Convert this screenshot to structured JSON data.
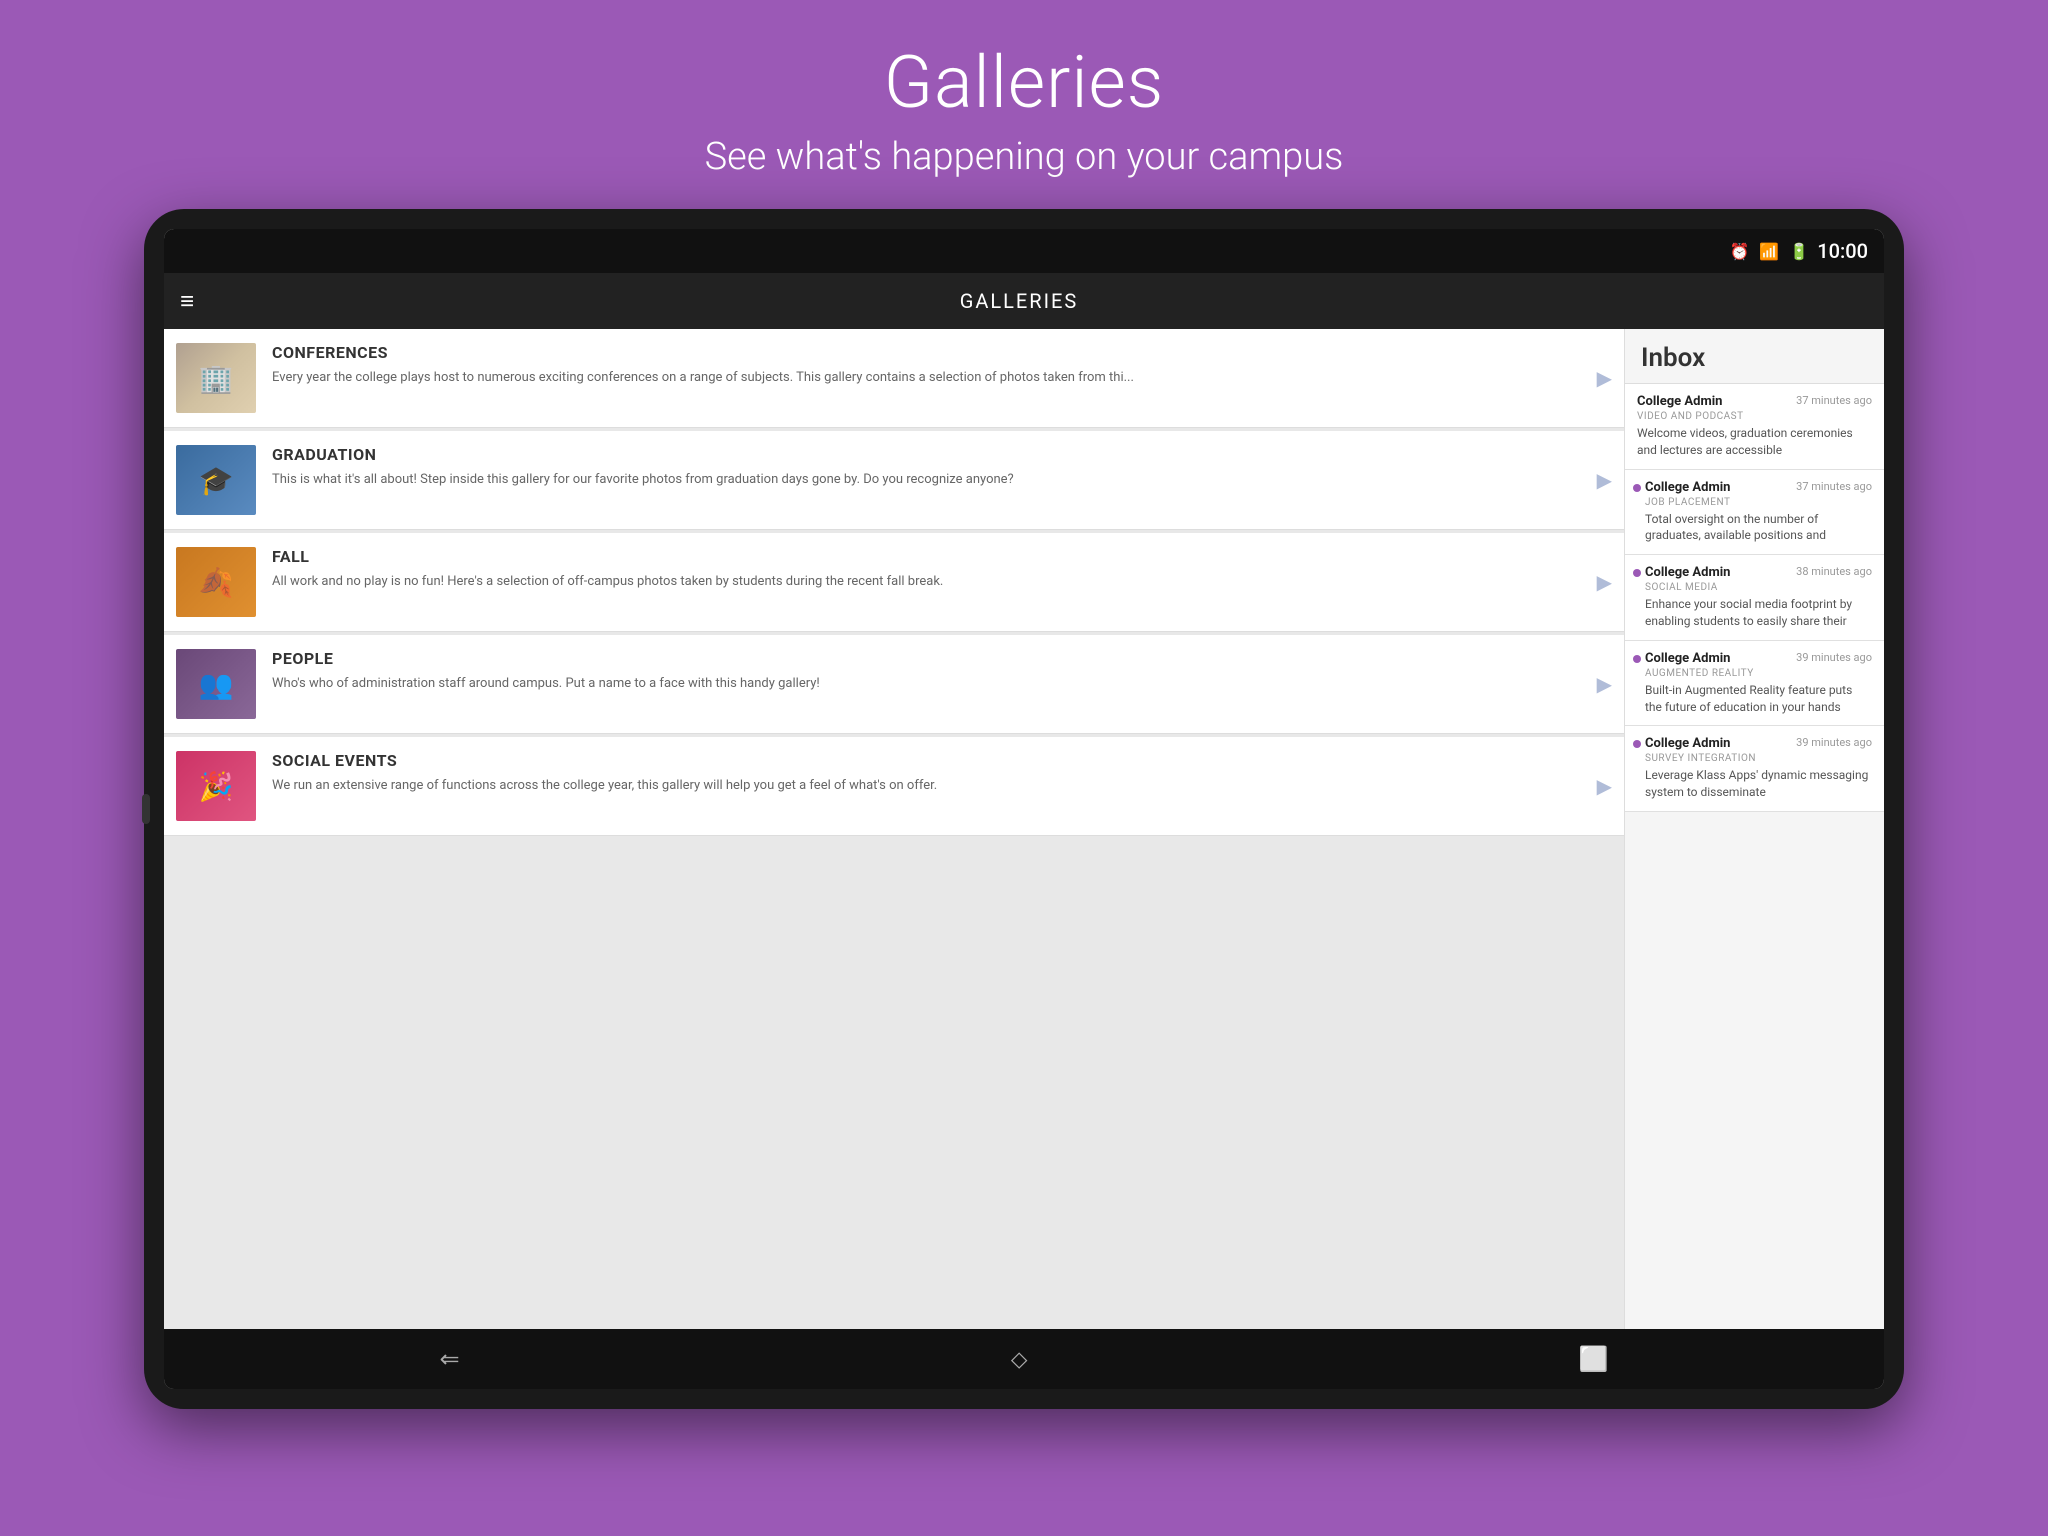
{
  "page": {
    "title": "Galleries",
    "subtitle": "See what's happening on your campus",
    "background_color": "#9b59b6"
  },
  "status_bar": {
    "time": "10:00",
    "icons": [
      "⏰",
      "📶",
      "🔋"
    ]
  },
  "app_bar": {
    "title": "GALLERIES",
    "menu_icon": "≡"
  },
  "gallery_items": [
    {
      "id": "conferences",
      "name": "CONFERENCES",
      "description": "Every year the college plays host to numerous exciting conferences on a range of subjects.  This gallery contains a selection of photos taken from thi...",
      "thumb_class": "thumb-conferences"
    },
    {
      "id": "graduation",
      "name": "GRADUATION",
      "description": "This is what it's all about!  Step inside this gallery for our favorite photos from graduation days gone by.  Do you recognize anyone?",
      "thumb_class": "thumb-graduation"
    },
    {
      "id": "fall",
      "name": "FALL",
      "description": "All work and no play is no fun!  Here's a selection of off-campus photos taken by students during the recent fall break.",
      "thumb_class": "thumb-fall"
    },
    {
      "id": "people",
      "name": "PEOPLE",
      "description": "Who's who of administration staff around campus.  Put a name to a face with this handy gallery!",
      "thumb_class": "thumb-people"
    },
    {
      "id": "social-events",
      "name": "SOCIAL EVENTS",
      "description": "We run an extensive range of functions across the college year, this gallery will help you get a feel of what's on offer.",
      "thumb_class": "thumb-social-events"
    }
  ],
  "inbox": {
    "title": "Inbox",
    "messages": [
      {
        "sender": "College Admin",
        "time": "37 minutes ago",
        "category": "VIDEO AND PODCAST",
        "preview": "Welcome videos, graduation ceremonies and lectures are accessible",
        "has_dot": false
      },
      {
        "sender": "College Admin",
        "time": "37 minutes ago",
        "category": "JOB PLACEMENT",
        "preview": "Total oversight on the number of graduates, available positions and",
        "has_dot": true
      },
      {
        "sender": "College Admin",
        "time": "38 minutes ago",
        "category": "SOCIAL MEDIA",
        "preview": "Enhance your social media footprint by enabling students to easily share their",
        "has_dot": true
      },
      {
        "sender": "College Admin",
        "time": "39 minutes ago",
        "category": "AUGMENTED REALITY",
        "preview": "Built-in Augmented Reality feature puts the future of education in your hands",
        "has_dot": true
      },
      {
        "sender": "College Admin",
        "time": "39 minutes ago",
        "category": "SURVEY INTEGRATION",
        "preview": "Leverage Klass Apps' dynamic messaging system to disseminate",
        "has_dot": true
      }
    ]
  },
  "nav_bar": {
    "back_label": "⬅",
    "home_label": "⬦",
    "recents_label": "⬜"
  }
}
